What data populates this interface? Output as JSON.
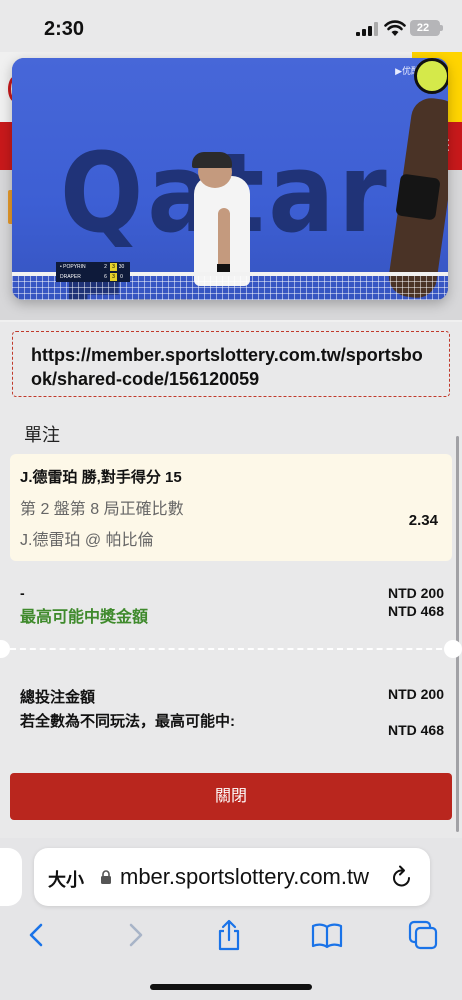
{
  "status_bar": {
    "time": "2:30",
    "battery": "22"
  },
  "video": {
    "watermark": "▶优酷体育",
    "sign_text": "Qatar Ex",
    "scoreboard": [
      {
        "name": "• POPYRIN",
        "s1": "2",
        "s2": "3",
        "s3": "30"
      },
      {
        "name": "  DRAPER",
        "s1": "6",
        "s2": "3",
        "s3": "0"
      }
    ]
  },
  "shared_url": "https://member.sportslottery.com.tw/sportsbook/shared-code/156120059",
  "bet_slip": {
    "section_title": "單注",
    "selection": "J.德雷珀 勝,對手得分 15",
    "market": "第 2 盤第 8 局正確比數",
    "event": "J.德雷珀 @ 帕比倫",
    "odds": "2.34",
    "stake_label": "-",
    "stake_amount": "NTD 200",
    "max_win_label": "最高可能中獎金額",
    "max_win_amount": "NTD 468",
    "total_label": "總投注金額",
    "total_amount": "NTD 200",
    "max_win_all_label": "若全數為不同玩法，最高可能中:",
    "max_win_all_amount": "NTD 468",
    "close_label": "關閉"
  },
  "safari": {
    "text_size_label": "大小",
    "address": "mber.sportslottery.com.tw"
  },
  "colors": {
    "accent_red": "#b9261e",
    "win_green": "#3f8a2c",
    "dashed_border": "#c0392b"
  }
}
